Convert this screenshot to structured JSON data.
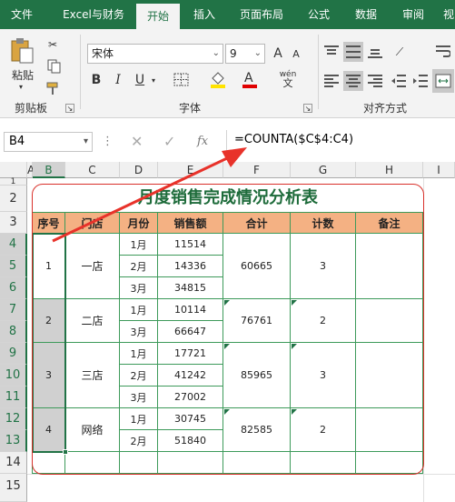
{
  "tabs": [
    "文件",
    "Excel与财务",
    "开始",
    "插入",
    "页面布局",
    "公式",
    "数据",
    "审阅",
    "视"
  ],
  "ribbon": {
    "paste_label": "粘贴",
    "clipboard_label": "剪贴板",
    "font_group_label": "字体",
    "align_group_label": "对齐方式",
    "font_name": "宋体",
    "font_size": "9",
    "bold": "B",
    "italic": "I",
    "underline": "U",
    "grow_font": "A",
    "shrink_font": "A",
    "wen": "wén"
  },
  "formula_bar": {
    "name_box": "B4",
    "fx": "fx",
    "formula": "=COUNTA($C$4:C4)"
  },
  "columns": [
    "A",
    "B",
    "C",
    "D",
    "E",
    "F",
    "G",
    "H",
    "I"
  ],
  "rows": [
    "1",
    "2",
    "3",
    "4",
    "5",
    "6",
    "7",
    "8",
    "9",
    "10",
    "11",
    "12",
    "13",
    "14",
    "15"
  ],
  "table": {
    "title": "月度销售完成情况分析表",
    "headers": [
      "序号",
      "门店",
      "月份",
      "销售额",
      "合计",
      "计数",
      "备注"
    ],
    "groups": [
      {
        "seq": "1",
        "store": "一店",
        "total": "60665",
        "count": "3",
        "rows": [
          {
            "month": "1月",
            "sales": "11514"
          },
          {
            "month": "2月",
            "sales": "14336"
          },
          {
            "month": "3月",
            "sales": "34815"
          }
        ]
      },
      {
        "seq": "2",
        "store": "二店",
        "total": "76761",
        "count": "2",
        "rows": [
          {
            "month": "1月",
            "sales": "10114"
          },
          {
            "month": "3月",
            "sales": "66647"
          }
        ]
      },
      {
        "seq": "3",
        "store": "三店",
        "total": "85965",
        "count": "3",
        "rows": [
          {
            "month": "1月",
            "sales": "17721"
          },
          {
            "month": "2月",
            "sales": "41242"
          },
          {
            "month": "3月",
            "sales": "27002"
          }
        ]
      },
      {
        "seq": "4",
        "store": "网络",
        "total": "82585",
        "count": "2",
        "rows": [
          {
            "month": "1月",
            "sales": "30745"
          },
          {
            "month": "2月",
            "sales": "51840"
          }
        ]
      }
    ]
  },
  "colors": {
    "excel_green": "#217346",
    "header_fill": "#f4b183",
    "border": "#3d9a5a",
    "title": "#1d6b3a",
    "arrow": "#e8322a",
    "frame": "#d9302a",
    "selection_fill": "#d0d0d0"
  }
}
